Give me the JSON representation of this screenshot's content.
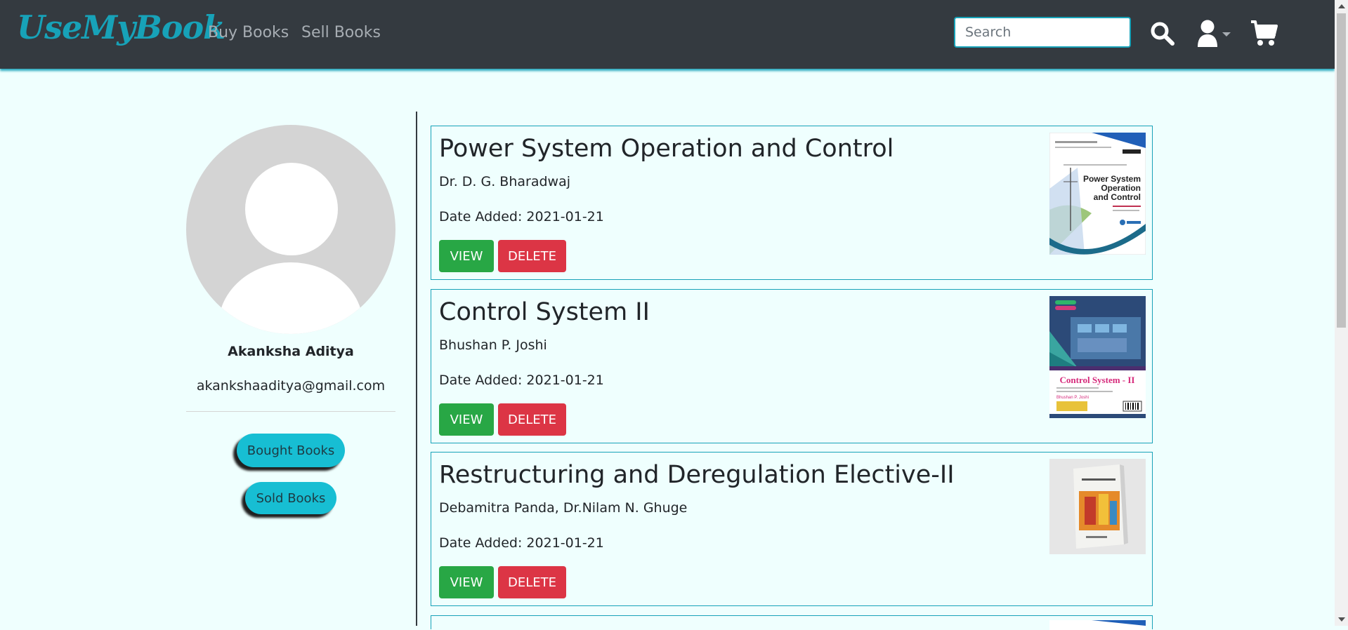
{
  "navbar": {
    "brand": "UseMyBook",
    "links": [
      "Buy Books",
      "Sell Books"
    ],
    "search_placeholder": "Search",
    "icons": [
      "search-icon",
      "user-icon",
      "cart-icon"
    ]
  },
  "profile": {
    "name": "Akanksha Aditya",
    "email": "akankshaaditya@gmail.com",
    "buttons": [
      "Bought Books",
      "Sold Books"
    ]
  },
  "books": [
    {
      "title": "Power System Operation and Control",
      "author": "Dr. D. G. Bharadwaj",
      "date_added": "Date Added: 2021-01-21",
      "view_label": "VIEW",
      "delete_label": "DELETE",
      "cover_text": [
        "Power System",
        "Operation",
        "and Control"
      ]
    },
    {
      "title": "Control System II",
      "author": "Bhushan P. Joshi",
      "date_added": "Date Added: 2021-01-21",
      "view_label": "VIEW",
      "delete_label": "DELETE",
      "cover_text": [
        "Control System - II",
        "Bhushan P. Joshi"
      ]
    },
    {
      "title": "Restructuring and Deregulation Elective-II",
      "author": "Debamitra Panda, Dr.Nilam N. Ghuge",
      "date_added": "Date Added: 2021-01-21",
      "view_label": "VIEW",
      "delete_label": "DELETE",
      "cover_text": []
    }
  ],
  "colors": {
    "accent": "#17a2b8",
    "navbar": "#343a40",
    "background": "#effffe",
    "view": "#28a745",
    "delete": "#dc3545"
  }
}
